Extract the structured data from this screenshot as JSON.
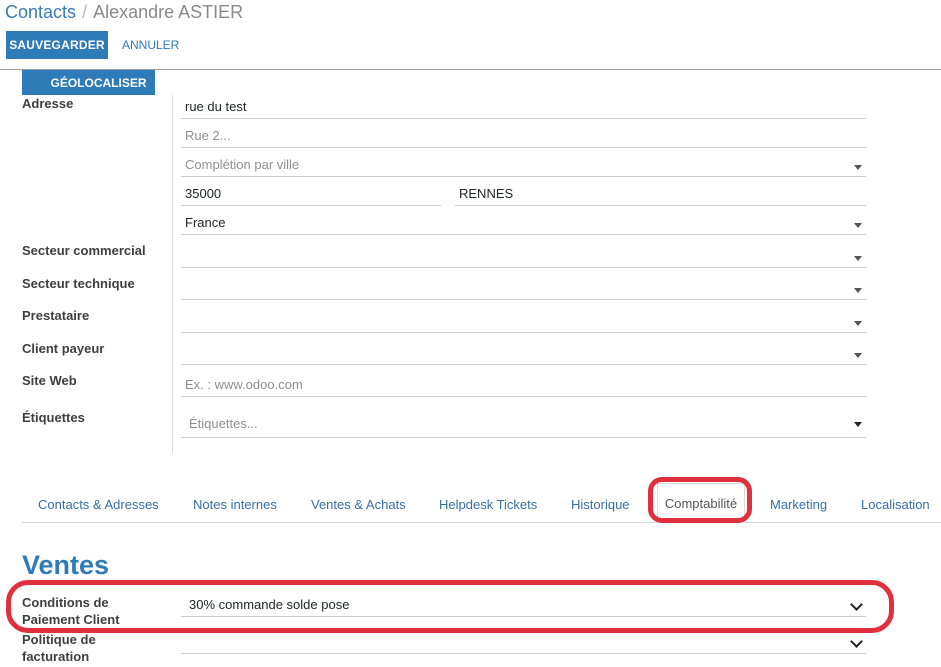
{
  "header": {
    "breadcrumb_root": "Contacts",
    "breadcrumb_separator": "/",
    "breadcrumb_current": "Alexandre ASTIER",
    "save_label": "SAUVEGARDER",
    "cancel_label": "ANNULER"
  },
  "form": {
    "geolocate_label": "GÉOLOCALISER",
    "address": {
      "label": "Adresse",
      "street": "rue du test",
      "street2_placeholder": "Rue 2...",
      "city_completion_placeholder": "Complétion par ville",
      "zip": "35000",
      "city": "RENNES",
      "country": "France"
    },
    "commercial_sector": {
      "label": "Secteur commercial"
    },
    "technical_sector": {
      "label": "Secteur technique"
    },
    "provider": {
      "label": "Prestataire"
    },
    "paying_client": {
      "label": "Client payeur"
    },
    "website": {
      "label": "Site Web",
      "placeholder": "Ex. : www.odoo.com"
    },
    "tags": {
      "label": "Étiquettes",
      "placeholder": "Étiquettes..."
    }
  },
  "tabs": [
    {
      "label": "Contacts & Adresses"
    },
    {
      "label": "Notes internes"
    },
    {
      "label": "Ventes & Achats"
    },
    {
      "label": "Helpdesk Tickets"
    },
    {
      "label": "Historique"
    },
    {
      "label": "Comptabilité",
      "active": true
    },
    {
      "label": "Marketing"
    },
    {
      "label": "Localisation"
    }
  ],
  "sales": {
    "section_title": "Ventes",
    "payment_terms_label_line1": "Conditions de",
    "payment_terms_label_line2": "Paiement Client",
    "payment_terms_value": "30% commande solde pose",
    "invoicing_policy_label_line1": "Politique de",
    "invoicing_policy_label_line2": "facturation"
  },
  "colors": {
    "primary": "#2f7ab8",
    "link": "#3a6ea5",
    "annotation": "#e0303d"
  }
}
